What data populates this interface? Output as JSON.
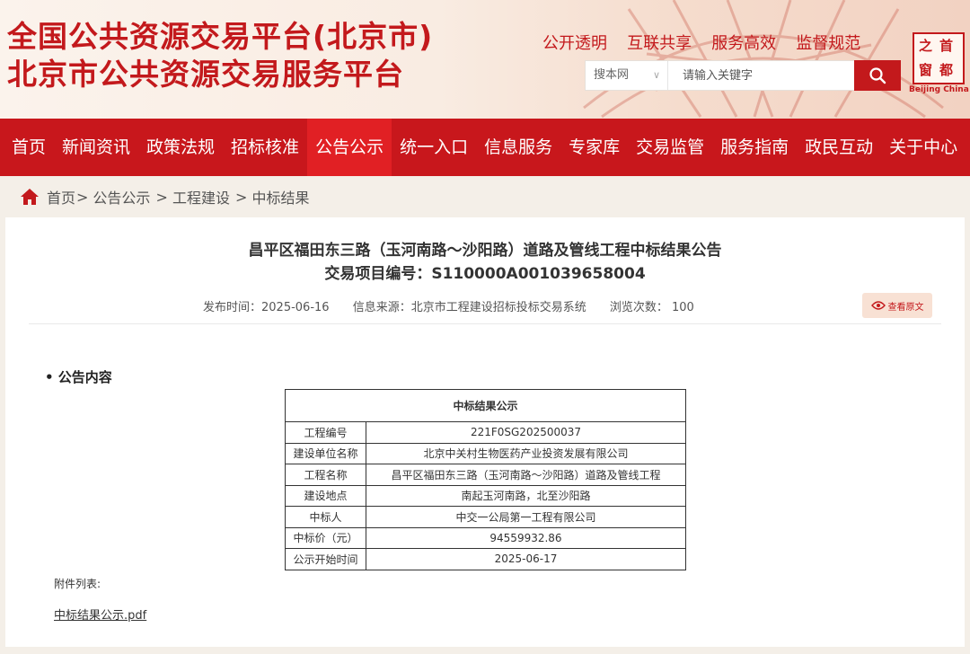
{
  "header": {
    "title_line1": "全国公共资源交易平台(北京市)",
    "title_line2": "北京市公共资源交易服务平台",
    "slogans": [
      "公开透明",
      "互联共享",
      "服务高效",
      "监督规范"
    ],
    "search": {
      "scope": "搜本网",
      "placeholder": "请输入关键字"
    },
    "logo": {
      "chars": [
        "首",
        "都",
        "之",
        "窗"
      ],
      "en": "Beijing China"
    }
  },
  "nav": {
    "items": [
      "首页",
      "新闻资讯",
      "政策法规",
      "招标核准",
      "公告公示",
      "统一入口",
      "信息服务",
      "专家库",
      "交易监管",
      "服务指南",
      "政民互动",
      "关于中心"
    ],
    "active": "公告公示"
  },
  "breadcrumb": [
    "首页",
    "公告公示",
    "工程建设",
    "中标结果"
  ],
  "article": {
    "title": "昌平区福田东三路（玉河南路～沙阳路）道路及管线工程中标结果公告",
    "subtitle": "交易项目编号：S110000A001039658004",
    "publish_time": "发布时间：2025-06-16",
    "source": "信息来源：北京市工程建设招标投标交易系统",
    "views": "浏览次数：  100",
    "view_original": "查看原文",
    "section_title": "• 公告内容",
    "table_title": "中标结果公示",
    "rows": [
      {
        "key": "工程编号",
        "value": "221F0SG202500037"
      },
      {
        "key": "建设单位名称",
        "value": "北京中关村生物医药产业投资发展有限公司"
      },
      {
        "key": "工程名称",
        "value": "昌平区福田东三路（玉河南路～沙阳路）道路及管线工程"
      },
      {
        "key": "建设地点",
        "value": "南起玉河南路，北至沙阳路"
      },
      {
        "key": "中标人",
        "value": "中交一公局第一工程有限公司"
      },
      {
        "key": "中标价（元）",
        "value": "94559932.86"
      },
      {
        "key": "公示开始时间",
        "value": "2025-06-17"
      }
    ],
    "attachments_label": "附件列表:",
    "attachment": "中标结果公示.pdf"
  },
  "colors": {
    "brand_red": "#c3191c",
    "nav_bg": "#c8171c",
    "nav_active": "#e12024",
    "page_bg": "#f4efe8"
  },
  "icons": [
    "search-icon",
    "home-icon",
    "eye-icon",
    "chevron-down-icon"
  ]
}
